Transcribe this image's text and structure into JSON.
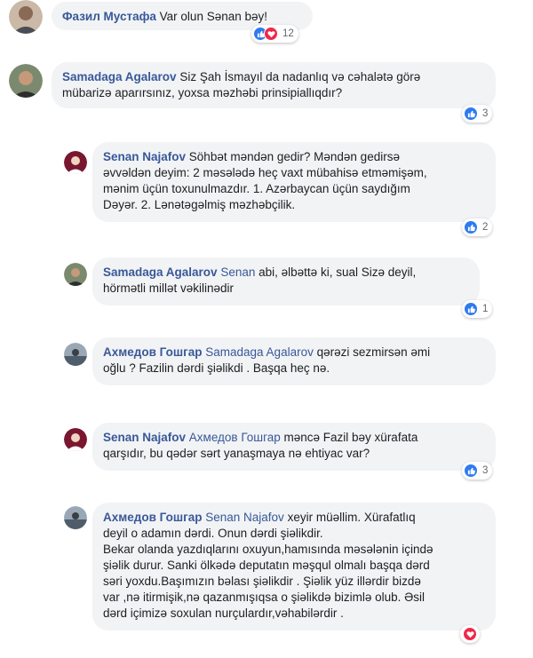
{
  "comments": [
    {
      "author": "Фазил Мустафа",
      "mention": "",
      "text": "Var olun Sənan bəy!",
      "reaction_count": "12",
      "reactions": [
        "like-icon",
        "love-icon"
      ]
    },
    {
      "author": "Samadaga Agalarov",
      "mention": "",
      "text_lines": [
        "Siz Şah İsmayıl da nadanlıq və cəhalətə görə",
        "mübarizə aparırsınız, yoxsa məzhəbi prinsipiallıqdır?"
      ],
      "reaction_count": "3",
      "reactions": [
        "like-icon"
      ]
    },
    {
      "author": "Senan Najafov",
      "mention": "",
      "text_lines": [
        "Söhbət məndən gedir? Məndən gedirsə",
        "əvvəldən deyim: 2 məsələdə heç vaxt mübahisə etməmişəm,",
        "mənim üçün toxunulmazdır. 1. Azərbaycan üçün saydığım",
        "Dəyər. 2. Lənətəgəlmiş məzhəbçilik."
      ],
      "reaction_count": "2",
      "reactions": [
        "like-icon"
      ]
    },
    {
      "author": "Samadaga Agalarov",
      "mention": "Senan",
      "text_lines": [
        "abi, əlbəttə ki, sual Sizə deyil,",
        "hörmətli millət vəkilinədir"
      ],
      "reaction_count": "1",
      "reactions": [
        "like-icon"
      ]
    },
    {
      "author": "Ахмедов Гошгар",
      "mention": "Samadaga Agalarov",
      "text_lines": [
        "qərəzi sezmirsən əmi",
        "oğlu ? Fazilin dərdi şiəlikdi . Başqa heç nə."
      ],
      "reaction_count": "",
      "reactions": []
    },
    {
      "author": "Senan Najafov",
      "mention": "Ахмедов Гошгар",
      "text_lines": [
        "məncə Fazil bəy xürafata",
        "qarşıdır, bu qədər sərt yanaşmaya nə ehtiyac var?"
      ],
      "reaction_count": "3",
      "reactions": [
        "like-icon"
      ]
    },
    {
      "author": "Ахмедов Гошгар",
      "mention": "Senan Najafov",
      "text_lines": [
        "xeyir müəllim. Xürafatlıq",
        "deyil o adamın dərdi. Onun dərdi şiəlikdir.",
        "Bekar olanda yazdıqlarını oxuyun,hamısında məsələnin içində",
        "şiəlik durur. Sanki ölkədə deputatın məşqul olmalı başqa dərd",
        "səri yoxdu.Başımızın bəlası şiəlikdir . Şiəlik yüz illərdir bizdə",
        "var ,nə itirmişik,nə qazanmışıqsa o şiəlikdə bizimlə olub. Əsil",
        "dərd içimizə soxulan nurçulardır,vəhabilərdir ."
      ],
      "reaction_count": "",
      "reactions": [
        "love-icon"
      ]
    }
  ]
}
